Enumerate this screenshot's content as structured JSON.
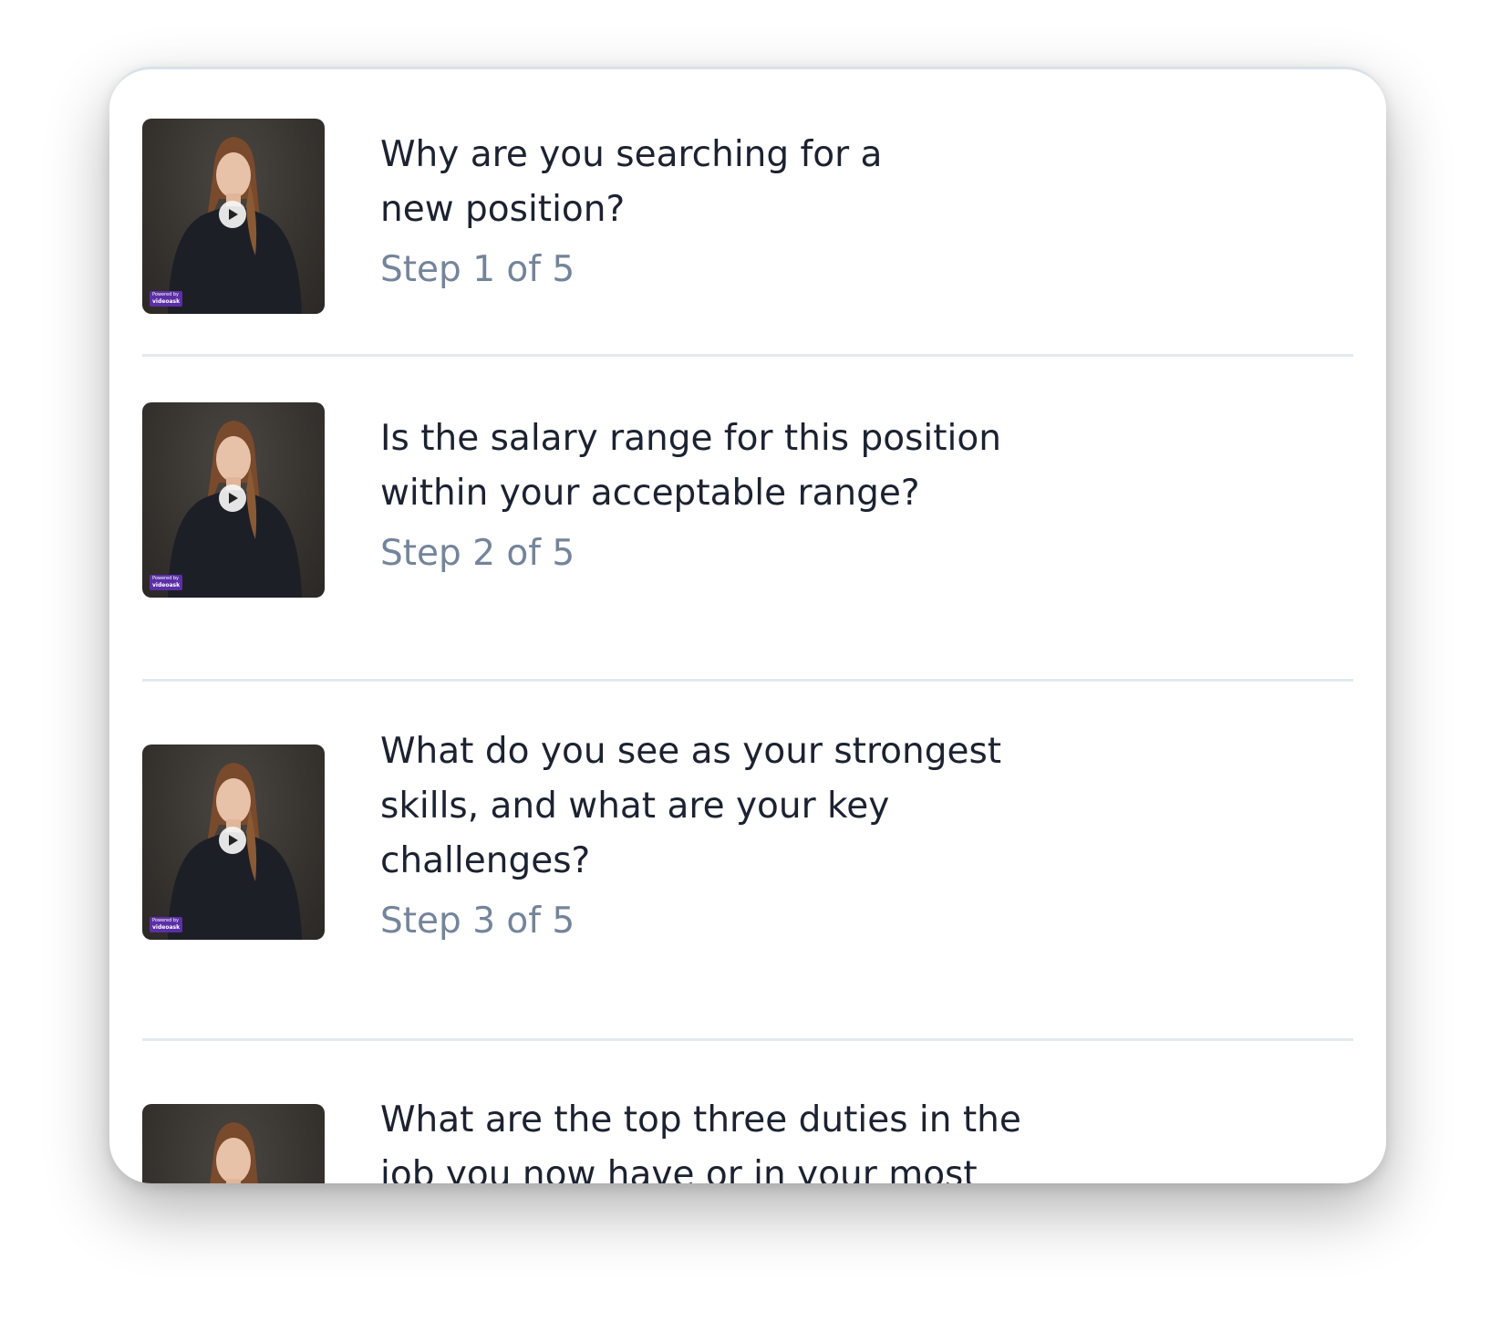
{
  "colors": {
    "question_text": "#1c2230",
    "step_text": "#74849a",
    "divider": "#e3e9f0",
    "brand_badge": "#5b2fa6"
  },
  "thumbnail": {
    "brand_line1": "Powered by",
    "brand_line2": "videoask",
    "play_icon": "play-icon"
  },
  "steps": [
    {
      "question_line1": "Why are you searching for a",
      "question_line2": "new position?",
      "question_line3": "",
      "step_label": "Step 1 of 5"
    },
    {
      "question_line1": "Is the salary range for this position",
      "question_line2": "within your acceptable range?",
      "question_line3": "",
      "step_label": "Step 2 of 5"
    },
    {
      "question_line1": "What do you see as your strongest",
      "question_line2": "skills, and what are your key",
      "question_line3": "challenges?",
      "step_label": "Step 3 of 5"
    },
    {
      "question_line1": "What are the top three duties in the",
      "question_line2": "job you now have or in your most",
      "question_line3": "",
      "step_label": ""
    }
  ]
}
